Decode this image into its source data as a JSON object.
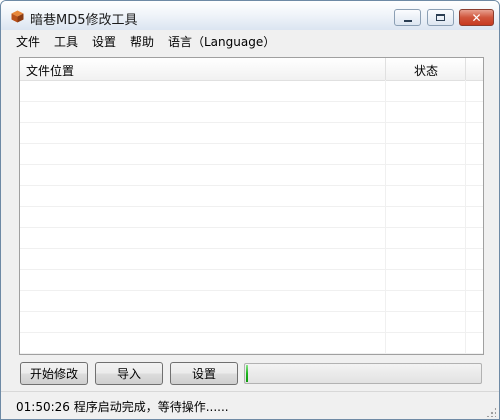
{
  "window": {
    "title": "暗巷MD5修改工具",
    "icon": "cube-icon",
    "controls": {
      "minimize": "minimize-icon",
      "maximize": "maximize-icon",
      "close": "✕"
    }
  },
  "menu": {
    "items": [
      {
        "label": "文件"
      },
      {
        "label": "工具"
      },
      {
        "label": "设置"
      },
      {
        "label": "帮助"
      },
      {
        "label": "语言（Language）"
      }
    ]
  },
  "list": {
    "columns": [
      {
        "label": "文件位置"
      },
      {
        "label": "状态"
      }
    ],
    "rows": []
  },
  "buttons": {
    "start": "开始修改",
    "import": "导入",
    "settings": "设置"
  },
  "progress": {
    "value": 0.01,
    "color": "#1fb41f"
  },
  "status": {
    "text": "01:50:26 程序启动完成，等待操作......"
  }
}
